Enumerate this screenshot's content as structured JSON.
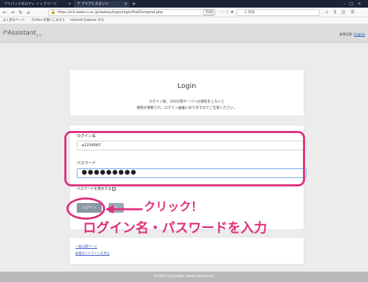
{
  "browser": {
    "tabs": [
      {
        "label": "アイパッドのロティ トップページ"
      },
      {
        "label": "ア アイアシスタント"
      }
    ],
    "url": "https://is3.iwate-u.ac.jp/iwateju/login/login/fileID/original.php",
    "zoom": "110%",
    "search_placeholder": "Q 検索",
    "bookmarks": [
      "よく見るページ",
      "Firefox を使いこなそう",
      "Internet Explorer から"
    ]
  },
  "app": {
    "logo": "i*Assistant",
    "logo_version": "2.0",
    "header_right_prefix": "表現言語: ",
    "header_right_link": "English"
  },
  "login_card": {
    "title": "Login",
    "notice_line1": "ログイン後、100分間サーバへの通信をしないと",
    "notice_line2": "接続が遮断され、ログイン画面に戻りますのでご注意ください。"
  },
  "form": {
    "username_label": "ログイン名",
    "username_value": "a1234567",
    "password_label": "パスワード",
    "password_value": "●●●●●●●●●",
    "show_password_label": "パスワードを表示する",
    "login_button": "ログイン",
    "second_button": "リ"
  },
  "links": [
    "一般公開ページ",
    "新着ガイドラインを見る"
  ],
  "footer": "©2023 Copyright: Iwate University",
  "annotations": {
    "click": "クリック！",
    "instruction": "ログイン名・パスワードを入力",
    "color": "#e0307c"
  }
}
